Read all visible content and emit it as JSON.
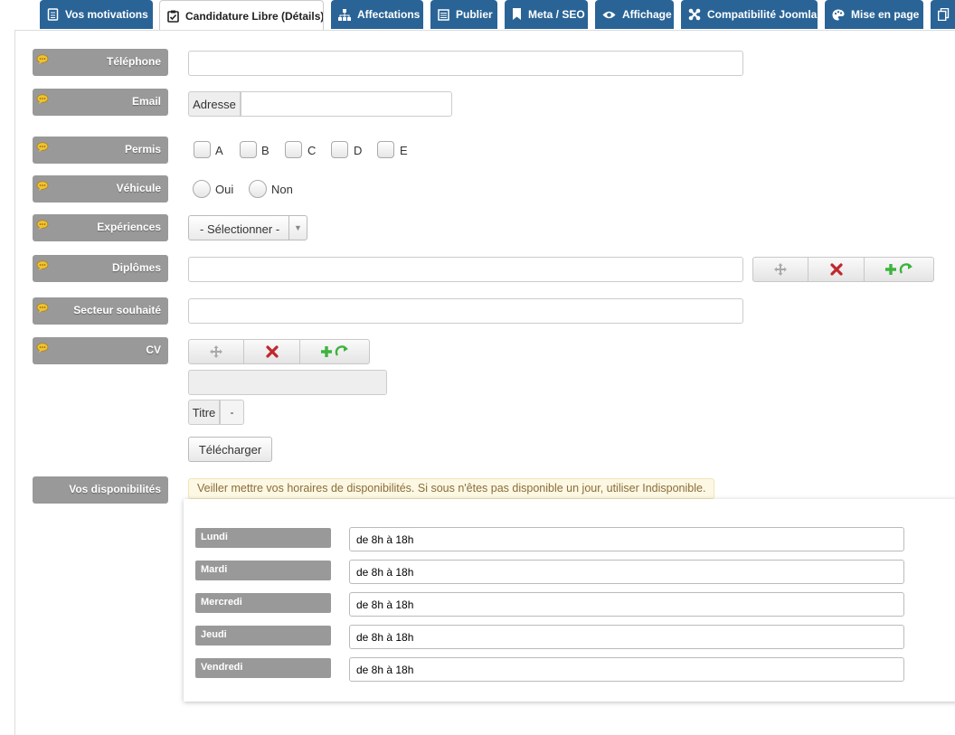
{
  "tabs": [
    {
      "label": "Vos motivations",
      "icon": "document-icon"
    },
    {
      "label": "Candidature Libre (Détails)",
      "icon": "checklist-icon",
      "active": true
    },
    {
      "label": "Affectations",
      "icon": "sitemap-icon"
    },
    {
      "label": "Publier",
      "icon": "calendar-icon"
    },
    {
      "label": "Meta / SEO",
      "icon": "bookmark-icon"
    },
    {
      "label": "Affichage",
      "icon": "eye-icon"
    },
    {
      "label": "Compatibilité Joomla",
      "icon": "joomla-icon"
    },
    {
      "label": "Mise en page",
      "icon": "palette-icon"
    }
  ],
  "form": {
    "telephone": {
      "label": "Téléphone",
      "value": ""
    },
    "email": {
      "label": "Email",
      "prefix": "Adresse",
      "value": ""
    },
    "permis": {
      "label": "Permis",
      "options": [
        "A",
        "B",
        "C",
        "D",
        "E"
      ]
    },
    "vehicule": {
      "label": "Véhicule",
      "options": [
        "Oui",
        "Non"
      ]
    },
    "experiences": {
      "label": "Expériences",
      "selected": "- Sélectionner -"
    },
    "diplomes": {
      "label": "Diplômes",
      "value": ""
    },
    "secteur": {
      "label": "Secteur souhaité",
      "value": ""
    },
    "cv": {
      "label": "CV",
      "titre_label": "Titre",
      "titre_value": "-",
      "upload_label": "Télécharger"
    },
    "disponibilites": {
      "label": "Vos disponibilités",
      "notice": "Veiller mettre vos horaires de disponibilités. Si sous n'êtes pas disponible un jour, utiliser Indisponible.",
      "days": [
        {
          "label": "Lundi",
          "value": "de 8h à 18h"
        },
        {
          "label": "Mardi",
          "value": "de 8h à 18h"
        },
        {
          "label": "Mercredi",
          "value": "de 8h à 18h"
        },
        {
          "label": "Jeudi",
          "value": "de 8h à 18h"
        },
        {
          "label": "Vendredi",
          "value": "de 8h à 18h"
        }
      ]
    }
  },
  "colors": {
    "tab": "#2a6496",
    "label_bg": "#999999",
    "delete": "#c0272d",
    "add": "#3cb43c"
  }
}
